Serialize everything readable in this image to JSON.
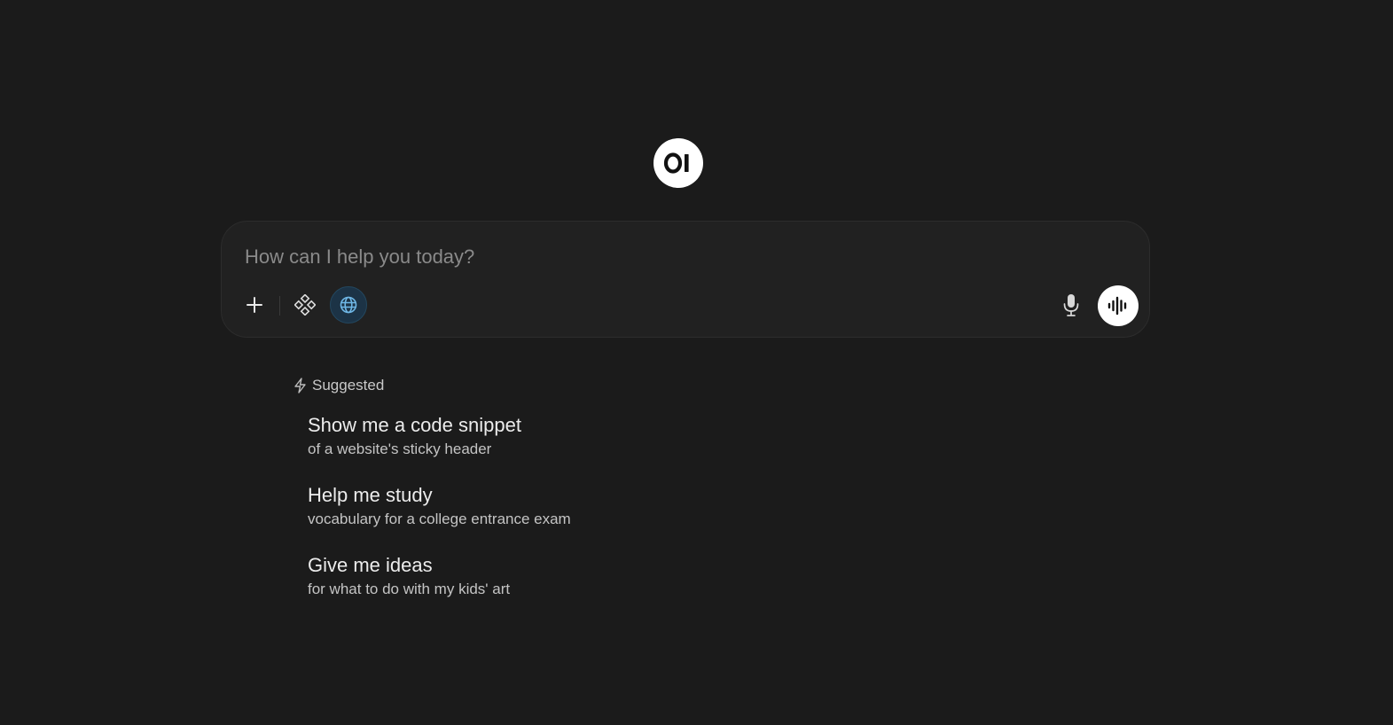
{
  "logo": {
    "text": "OI",
    "icon": "open-webui-logo"
  },
  "composer": {
    "placeholder": "How can I help you today?",
    "value": "",
    "buttons": {
      "add": "plus-icon",
      "tools": "tools-icon",
      "web_search": "globe-icon",
      "dictate": "microphone-icon",
      "voice_mode": "waveform-icon"
    },
    "web_search_active_color": "#1c3346",
    "accent": "#6fb7e6"
  },
  "suggested": {
    "header": "Suggested",
    "icon": "bolt-icon",
    "items": [
      {
        "title": "Show me a code snippet",
        "subtitle": "of a website's sticky header"
      },
      {
        "title": "Help me study",
        "subtitle": "vocabulary for a college entrance exam"
      },
      {
        "title": "Give me ideas",
        "subtitle": "for what to do with my kids' art"
      }
    ]
  }
}
